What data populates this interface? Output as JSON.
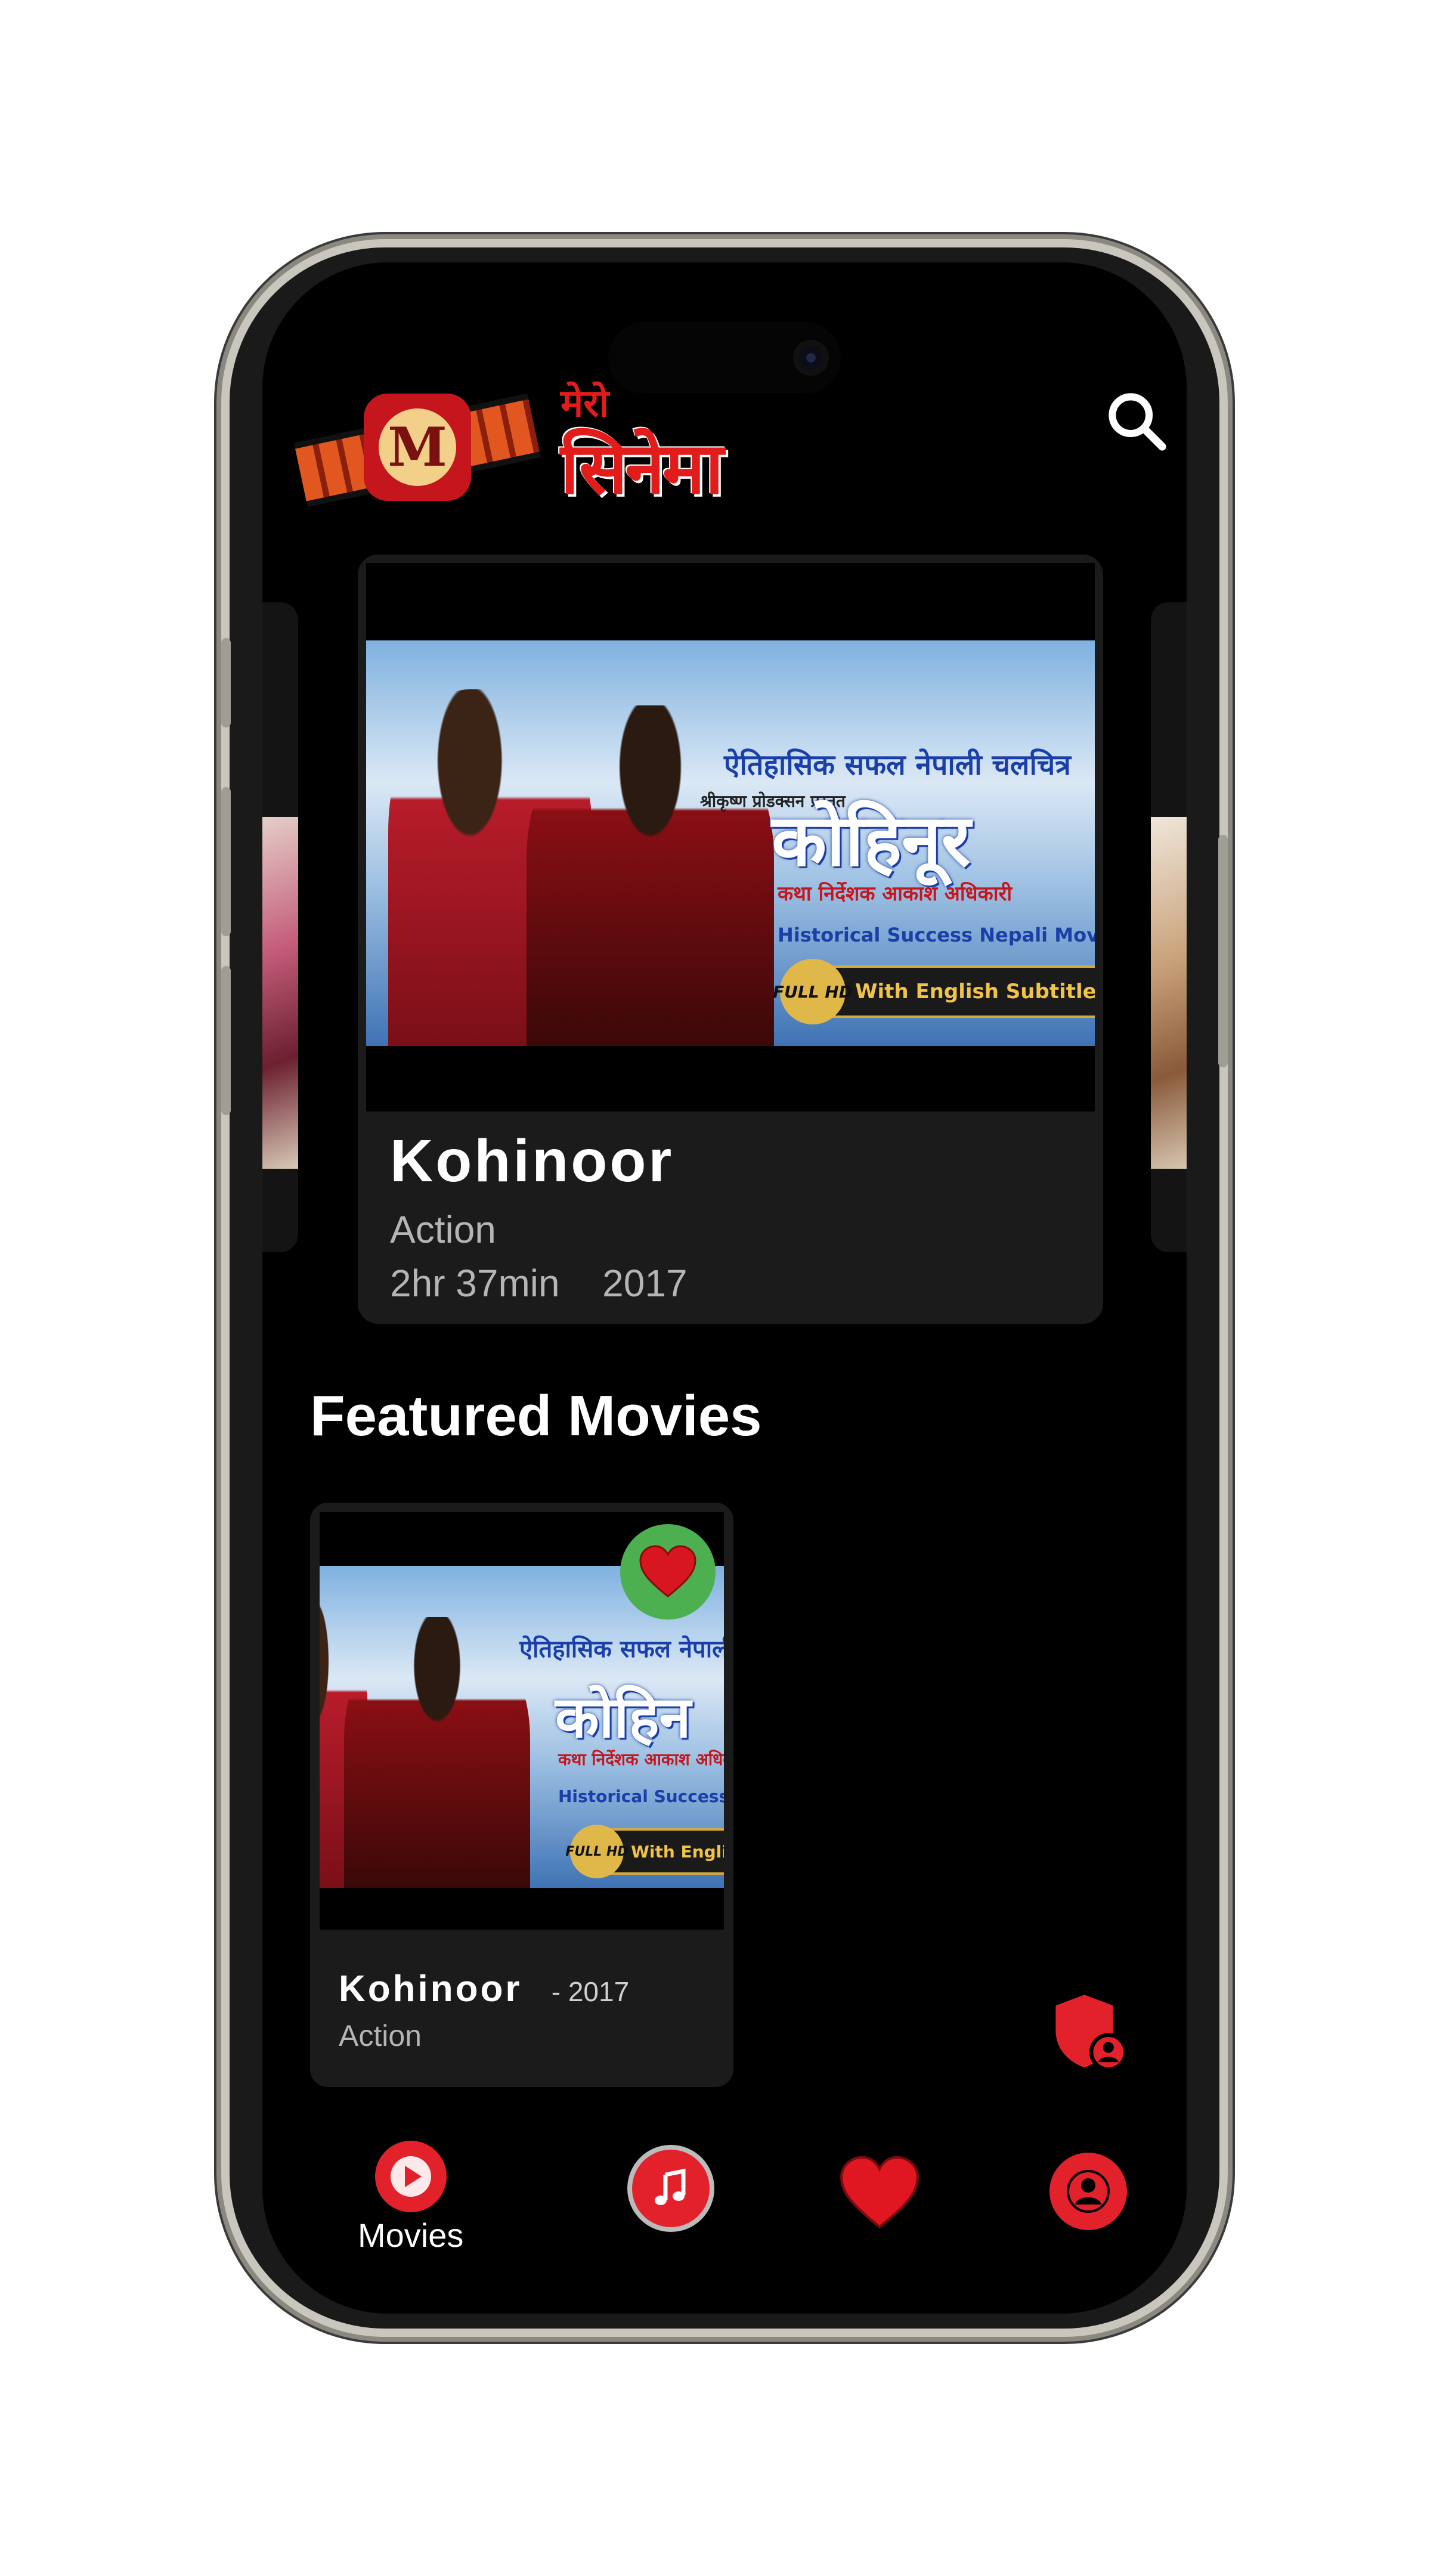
{
  "app": {
    "logo_text_small": "मेरो",
    "logo_text_large": "सिनेमा",
    "logo_monogram": "M",
    "search_icon": "search-icon"
  },
  "carousel": {
    "active": {
      "title": "Kohinoor",
      "genre": "Action",
      "duration": "2hr 37min",
      "year": "2017",
      "poster": {
        "tagline_np": "ऐतिहासिक सफल नेपाली चलचित्र",
        "presenter_np": "श्रीकृष्ण प्रोडक्सन प्रस्तुत",
        "title_np": "कोहिनूर",
        "director_np": "कथा निर्देशक आकाश अधिकारी",
        "subtitle_en": "Historical Success Nepali Movie",
        "badge_hd": "FULL HD",
        "badge_text": "With English Subtitle"
      }
    }
  },
  "featured": {
    "heading": "Featured Movies",
    "items": [
      {
        "title": "Kohinoor",
        "year": "- 2017",
        "genre": "Action",
        "favorite_icon": "heart-icon",
        "poster": {
          "tagline_np": "ऐतिहासिक सफल नेपाली",
          "title_np": "कोहिन",
          "director_np": "कथा निर्देशक आकाश अधिक",
          "subtitle_en": "Historical Success Nepa",
          "badge_hd": "FULL HD",
          "badge_text": "With English"
        }
      }
    ]
  },
  "floating": {
    "icon": "shield-user-icon"
  },
  "bottom_nav": {
    "items": [
      {
        "label": "Movies",
        "icon": "play-icon",
        "active": true
      },
      {
        "label": "",
        "icon": "music-icon",
        "active": false
      },
      {
        "label": "",
        "icon": "heart-icon",
        "active": false
      },
      {
        "label": "",
        "icon": "profile-icon",
        "active": false
      }
    ]
  },
  "colors": {
    "accent": "#e3212b",
    "background": "#000000",
    "card": "#1b1b1b",
    "favorite_bg": "#4caf50"
  }
}
